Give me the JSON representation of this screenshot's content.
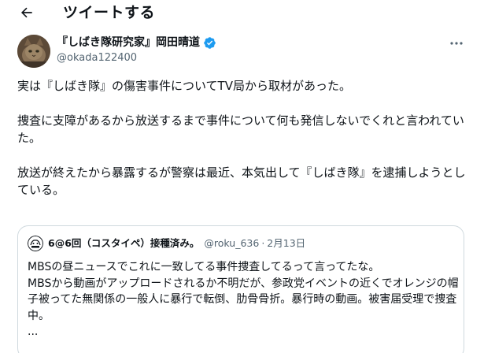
{
  "header": {
    "title": "ツイートする",
    "back_icon": "arrow-left-icon"
  },
  "author": {
    "name": "『しばき隊研究家』岡田晴道",
    "handle": "@okada122400",
    "verified": true,
    "verified_color": "#1d9bf0"
  },
  "tweet": {
    "paragraphs": [
      "実は『しばき隊』の傷害事件についてTV局から取材があった。",
      "捜査に支障があるから放送するまで事件について何も発信しないでくれと言われていた。",
      "放送が終えたから暴露するが警察は最近、本気出して『しばき隊』を逮捕しようとしている。"
    ]
  },
  "quote": {
    "name": "6@6回（コスタイペ）接種済み。",
    "handle": "@roku_636",
    "separator": "·",
    "date": "2月13日",
    "lines": [
      "MBSの昼ニュースでこれに一致してる事件捜査してるって言ってたな。",
      "MBSから動画がアップロードされるか不明だが、参政党イベントの近くでオレンジの帽子被ってた無関係の一般人に暴行で転倒、肋骨骨折。暴行時の動画。被害届受理で捜査中。",
      "..."
    ]
  },
  "colors": {
    "text": "#0f1419",
    "secondary": "#536471",
    "border": "#cfd9de",
    "accent": "#1d9bf0"
  }
}
